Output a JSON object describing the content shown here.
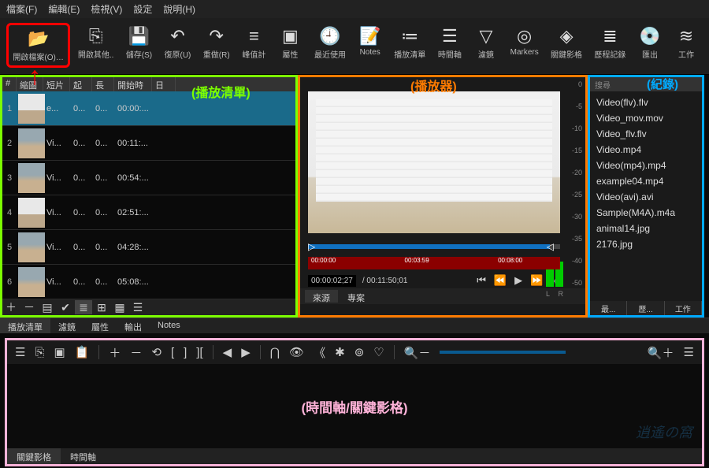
{
  "menu": {
    "file": "檔案(F)",
    "edit": "編輯(E)",
    "view": "檢視(V)",
    "settings": "設定",
    "help": "說明(H)"
  },
  "toolbar": [
    {
      "icon": "📂",
      "label": "開啟檔案(O)…",
      "name": "open-file-button",
      "hl": true
    },
    {
      "icon": "⎘",
      "label": "開啟其他..",
      "name": "open-other-button"
    },
    {
      "icon": "💾",
      "label": "儲存(S)",
      "name": "save-button"
    },
    {
      "icon": "↶",
      "label": "復原(U)",
      "name": "undo-button"
    },
    {
      "icon": "↷",
      "label": "重做(R)",
      "name": "redo-button"
    },
    {
      "icon": "≡",
      "label": "峰值計",
      "name": "peakmeter-button"
    },
    {
      "icon": "▣",
      "label": "屬性",
      "name": "properties-button"
    },
    {
      "icon": "🕘",
      "label": "最近使用",
      "name": "recent-button"
    },
    {
      "icon": "📝",
      "label": "Notes",
      "name": "notes-button"
    },
    {
      "icon": "≔",
      "label": "播放清單",
      "name": "playlist-button"
    },
    {
      "icon": "☰",
      "label": "時間軸",
      "name": "timeline-button"
    },
    {
      "icon": "▽",
      "label": "濾鏡",
      "name": "filters-button"
    },
    {
      "icon": "◎",
      "label": "Markers",
      "name": "markers-button"
    },
    {
      "icon": "◈",
      "label": "關鍵影格",
      "name": "keyframes-button"
    },
    {
      "icon": "≣",
      "label": "歷程記錄",
      "name": "history-button"
    },
    {
      "icon": "💿",
      "label": "匯出",
      "name": "export-button"
    },
    {
      "icon": "≋",
      "label": "工作",
      "name": "jobs-button"
    }
  ],
  "playlist": {
    "overlay": "(播放清單)",
    "headers": {
      "num": "#",
      "thumb": "縮圖",
      "clip": "短片",
      "in": "起點",
      "len": "長度",
      "start": "開始時間",
      "date": "日期"
    },
    "rows": [
      {
        "n": "1",
        "clip": "e...",
        "in": "0...",
        "len": "0...",
        "start": "00:00:...",
        "sel": true,
        "door": true
      },
      {
        "n": "2",
        "clip": "Vi...",
        "in": "0...",
        "len": "0...",
        "start": "00:11:..."
      },
      {
        "n": "3",
        "clip": "Vi...",
        "in": "0...",
        "len": "0...",
        "start": "00:54:..."
      },
      {
        "n": "4",
        "clip": "Vi...",
        "in": "0...",
        "len": "0...",
        "start": "02:51:...",
        "door": true
      },
      {
        "n": "5",
        "clip": "Vi...",
        "in": "0...",
        "len": "0...",
        "start": "04:28:..."
      },
      {
        "n": "6",
        "clip": "Vi...",
        "in": "0...",
        "len": "0...",
        "start": "05:08:..."
      }
    ],
    "footer_icons": [
      "＋",
      "－",
      "▤",
      "✔",
      "≣",
      "⊞",
      "▦",
      "☰"
    ]
  },
  "sub_tabs": [
    "播放清單",
    "濾鏡",
    "屬性",
    "輸出",
    "Notes"
  ],
  "player": {
    "overlay": "(播放器)",
    "scale": [
      "0",
      "-5",
      "-10",
      "-15",
      "-20",
      "-25",
      "-30",
      "-35",
      "-40",
      "-50"
    ],
    "lr_l": "L",
    "lr_r": "R",
    "scrub_in": "▷",
    "scrub_out": "◁",
    "ruler": [
      "00:00:00",
      "",
      "00:03:59",
      "",
      "00:08:00",
      ""
    ],
    "tc_current": "00:00:02;27",
    "tc_total": "/ 00:11:50;01",
    "transport_icons": [
      "⏮",
      "⏪",
      "▶",
      "⏩",
      "⏭"
    ],
    "source_tab": "來源",
    "project_tab": "專案"
  },
  "history": {
    "overlay": "(紀錄)",
    "search": "搜尋",
    "items": [
      "Video(flv).flv",
      "Video_mov.mov",
      "Video_flv.flv",
      "Video.mp4",
      "Video(mp4).mp4",
      "example04.mp4",
      "Video(avi).avi",
      "Sample(M4A).m4a",
      "animal14.jpg",
      "2176.jpg"
    ],
    "footer": [
      "最...",
      "歷...",
      "工作"
    ]
  },
  "timeline": {
    "overlay": "(時間軸/關鍵影格)",
    "toolbar_icons": [
      "☰",
      "⎘",
      "▣",
      "📋",
      "",
      "＋",
      "－",
      "⟲",
      "[",
      "]",
      "][",
      "",
      "◀",
      "▶",
      "",
      "⋂",
      "👁",
      "《",
      "✱",
      "⊚",
      "♡",
      "",
      "🔍－"
    ],
    "zoom_in": "🔍＋",
    "tabs": [
      "關鍵影格",
      "時間軸"
    ],
    "watermark": "逍遙の窩"
  }
}
